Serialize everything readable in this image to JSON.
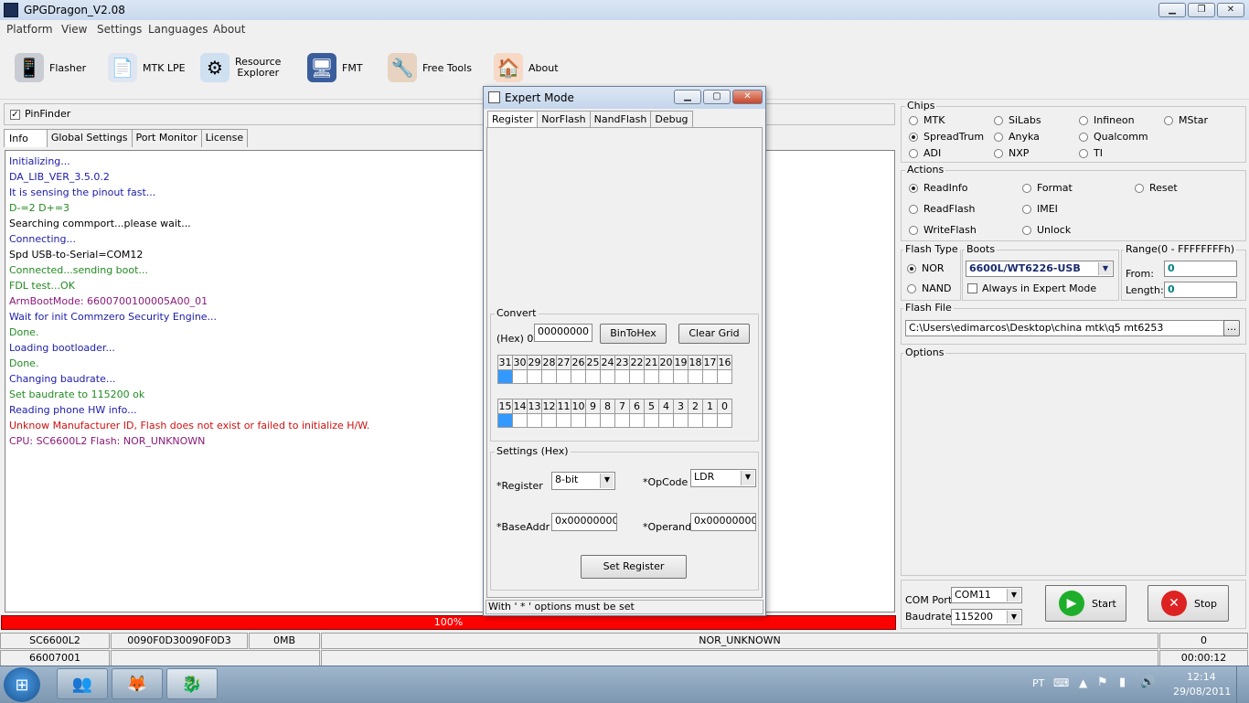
{
  "window": {
    "title": "GPGDragon_V2.08"
  },
  "menu": [
    "Platform",
    "View",
    "Settings",
    "Languages",
    "About"
  ],
  "toolbar": {
    "flasher": "Flasher",
    "mtk_lpe": "MTK LPE",
    "resource_explorer_1": "Resource",
    "resource_explorer_2": "Explorer",
    "fmt": "FMT",
    "free_tools": "Free Tools",
    "about": "About"
  },
  "left": {
    "pinfinder": "PinFinder",
    "tabs": [
      "Info",
      "Global Settings",
      "Port Monitor",
      "License"
    ],
    "log": [
      {
        "text": "Initializing...",
        "color": "#1c1caa"
      },
      {
        "text": "DA_LIB_VER_3.5.0.2",
        "color": "#1c1caa"
      },
      {
        "text": "It is sensing the pinout fast...",
        "color": "#1c1caa"
      },
      {
        "text": "D-=2  D+=3",
        "color": "#228b22"
      },
      {
        "text": "Searching commport...please wait...",
        "color": "#000000"
      },
      {
        "text": "Connecting...",
        "color": "#1c1caa"
      },
      {
        "text": "Spd USB-to-Serial=COM12",
        "color": "#000000"
      },
      {
        "text": "Connected...sending boot...",
        "color": "#228b22"
      },
      {
        "text": "FDL test...OK",
        "color": "#228b22"
      },
      {
        "text": "ArmBootMode: 6600700100005A00_01",
        "color": "#8b1a7a"
      },
      {
        "text": "Wait for init Commzero Security Engine...",
        "color": "#1c1caa"
      },
      {
        "text": "Done.",
        "color": "#228b22"
      },
      {
        "text": "Loading bootloader...",
        "color": "#1c1caa"
      },
      {
        "text": "Done.",
        "color": "#228b22"
      },
      {
        "text": "Changing baudrate...",
        "color": "#1c1caa"
      },
      {
        "text": "Set baudrate to 115200 ok",
        "color": "#228b22"
      },
      {
        "text": "Reading phone HW info...",
        "color": "#1c1caa"
      },
      {
        "text": "Unknow Manufacturer ID, Flash does not exist or failed to initialize H/W.",
        "color": "#d01010"
      },
      {
        "text": "CPU: SC6600L2      Flash: NOR_UNKNOWN",
        "color": "#8b1a7a"
      }
    ]
  },
  "progress": {
    "value": 100,
    "label": "100%"
  },
  "status": {
    "row1": [
      "SC6600L2",
      "0090F0D30090F0D3",
      "0MB",
      "NOR_UNKNOWN",
      "0"
    ],
    "row2": [
      "66007001",
      "00:00:12"
    ]
  },
  "dialog": {
    "title": "Expert Mode",
    "tabs": [
      "Register",
      "NorFlash",
      "NandFlash",
      "Debug"
    ],
    "convert": {
      "label": "Convert",
      "hex_label": "(Hex) 0x",
      "hex_value": "00000000",
      "bintohex": "BinToHex",
      "clear_grid": "Clear Grid",
      "bits_high": [
        "31",
        "30",
        "29",
        "28",
        "27",
        "26",
        "25",
        "24",
        "23",
        "22",
        "21",
        "20",
        "19",
        "18",
        "17",
        "16"
      ],
      "bits_low": [
        "15",
        "14",
        "13",
        "12",
        "11",
        "10",
        "9",
        "8",
        "7",
        "6",
        "5",
        "4",
        "3",
        "2",
        "1",
        "0"
      ]
    },
    "settings": {
      "label": "Settings (Hex)",
      "register_label": "*Register",
      "register_value": "8-bit",
      "opcode_label": "*OpCode",
      "opcode_value": "LDR",
      "baseaddr_label": "*BaseAddr",
      "baseaddr_value": "0x00000000",
      "operand_label": "*Operand",
      "operand_value": "0x00000000",
      "set_register": "Set Register"
    },
    "footer": "With ' * ' options must be set"
  },
  "right": {
    "chips": {
      "label": "Chips",
      "options": [
        "MTK",
        "SiLabs",
        "Infineon",
        "MStar",
        "SpreadTrum",
        "Anyka",
        "Qualcomm",
        "ADI",
        "NXP",
        "TI"
      ],
      "selected": "SpreadTrum"
    },
    "actions": {
      "label": "Actions",
      "options": [
        "ReadInfo",
        "Format",
        "Reset",
        "ReadFlash",
        "IMEI",
        "WriteFlash",
        "Unlock"
      ],
      "selected": "ReadInfo"
    },
    "flash_type": {
      "label": "Flash Type",
      "nor": "NOR",
      "nand": "NAND",
      "selected": "NOR"
    },
    "boots": {
      "label": "Boots",
      "value": "6600L/WT6226-USB",
      "expert": "Always in Expert Mode"
    },
    "range": {
      "label": "Range(0 - FFFFFFFFh)",
      "from_label": "From:",
      "from_value": "0",
      "length_label": "Length:",
      "length_value": "0"
    },
    "flash_file": {
      "label": "Flash File",
      "value": "C:\\Users\\edimarcos\\Desktop\\china mtk\\q5 mt6253",
      "browse": "..."
    },
    "options": {
      "label": "Options"
    },
    "com_port": {
      "label": "COM Port",
      "value": "COM11"
    },
    "baudrate": {
      "label": "Baudrate",
      "value": "115200"
    },
    "start": "Start",
    "stop": "Stop"
  },
  "taskbar": {
    "lang": "PT",
    "time": "12:14",
    "date": "29/08/2011"
  },
  "colors": {
    "accent": "#3399ff",
    "progress": "#ff0000",
    "start": "#1fae2b",
    "stop": "#d22"
  }
}
